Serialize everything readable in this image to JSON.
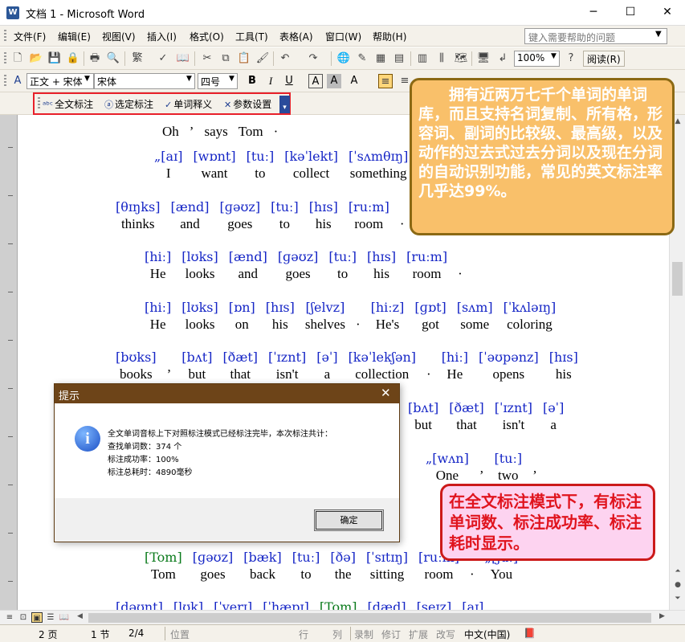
{
  "window": {
    "icon_letter": "W",
    "title": "文档 1 - Microsoft Word",
    "min": "─",
    "max": "☐",
    "close": "✕"
  },
  "menu": {
    "items": [
      "文件(F)",
      "编辑(E)",
      "视图(V)",
      "插入(I)",
      "格式(O)",
      "工具(T)",
      "表格(A)",
      "窗口(W)",
      "帮助(H)"
    ],
    "help_placeholder": "键入需要帮助的问题"
  },
  "toolbar": {
    "zoom": "100%",
    "reading": "阅读(R)",
    "style": "正文 + 宋体",
    "font": "宋体",
    "size": "四号",
    "bold": "B",
    "italic": "I",
    "underline": "U"
  },
  "addin": {
    "full_annotate": "全文标注",
    "selection_annotate": "选定标注",
    "word_definition": "单词释义",
    "settings": "参数设置"
  },
  "document": {
    "rows": [
      {
        "cells": [
          {
            "w": "Oh"
          },
          {
            "p": "’"
          },
          {
            "w": "says"
          },
          {
            "w": "Tom"
          },
          {
            "p": "·"
          }
        ]
      },
      {
        "cells": [
          {
            "ph": "„[aɪ]",
            "w": "I"
          },
          {
            "ph": "[wɒnt]",
            "w": "want"
          },
          {
            "ph": "[tuː]",
            "w": "to"
          },
          {
            "ph": "[kəˈlekt]",
            "w": "collect"
          },
          {
            "ph": "[ˈsʌmθɪŋ]",
            "w": "something"
          }
        ]
      },
      {
        "cells": [
          {
            "ph": "[θɪŋks]",
            "w": "thinks"
          },
          {
            "ph": "[ænd]",
            "w": "and"
          },
          {
            "ph": "[ɡəʊz]",
            "w": "goes"
          },
          {
            "ph": "[tuː]",
            "w": "to"
          },
          {
            "ph": "[hɪs]",
            "w": "his"
          },
          {
            "ph": "[ruːm]",
            "w": "room"
          },
          {
            "p": "·"
          }
        ]
      },
      {
        "cells": [
          {
            "ph": "[hiː]",
            "w": "He"
          },
          {
            "ph": "[lʊks]",
            "w": "looks"
          },
          {
            "ph": "[ænd]",
            "w": "and"
          },
          {
            "ph": "[ɡəʊz]",
            "w": "goes"
          },
          {
            "ph": "[tuː]",
            "w": "to"
          },
          {
            "ph": "[hɪs]",
            "w": "his"
          },
          {
            "ph": "[ruːm]",
            "w": "room"
          },
          {
            "p": "·"
          }
        ]
      },
      {
        "cells": [
          {
            "ph": "[hiː]",
            "w": "He"
          },
          {
            "ph": "[lʊks]",
            "w": "looks"
          },
          {
            "ph": "[ɒn]",
            "w": "on"
          },
          {
            "ph": "[hɪs]",
            "w": "his"
          },
          {
            "ph": "[ʃelvz]",
            "w": "shelves"
          },
          {
            "p": "·"
          },
          {
            "ph": "[hiːz]",
            "w": "He's"
          },
          {
            "ph": "[ɡɒt]",
            "w": "got"
          },
          {
            "ph": "[sʌm]",
            "w": "some"
          },
          {
            "ph": "[ˈkʌləɪŋ]",
            "w": "coloring"
          }
        ]
      },
      {
        "cells": [
          {
            "ph": "[bʊks]",
            "w": "books"
          },
          {
            "p": "’"
          },
          {
            "ph": "[bʌt]",
            "w": "but"
          },
          {
            "ph": "[ðæt]",
            "w": "that"
          },
          {
            "ph": "[ˈɪznt]",
            "w": "isn't"
          },
          {
            "ph": "[əˈ]",
            "w": "a"
          },
          {
            "ph": "[kəˈlekʃən]",
            "w": "collection"
          },
          {
            "p": "·"
          },
          {
            "ph": "[hiː]",
            "w": "He"
          },
          {
            "ph": "[ˈəʊpənz]",
            "w": "opens"
          },
          {
            "ph": "[hɪs]",
            "w": "his"
          }
        ]
      },
      {
        "cells": [
          {
            "ph": "[bʌt]",
            "w": "but"
          },
          {
            "ph": "[ðæt]",
            "w": "that"
          },
          {
            "ph": "[ˈɪznt]",
            "w": "isn't"
          },
          {
            "ph": "[əˈ]",
            "w": "a"
          }
        ]
      },
      {
        "cells": [
          {
            "ph": "„[wʌn]",
            "w": "One"
          },
          {
            "p": "’"
          },
          {
            "ph": "[tuː]",
            "w": "two"
          },
          {
            "p": "’"
          }
        ]
      },
      {
        "cells": [
          {
            "ph": "[Tom]",
            "w": "Tom",
            "g": true
          },
          {
            "ph": "[ɡəʊz]",
            "w": "goes"
          },
          {
            "ph": "[bæk]",
            "w": "back"
          },
          {
            "ph": "[tuː]",
            "w": "to"
          },
          {
            "ph": "[ðə]",
            "w": "the"
          },
          {
            "ph": "[ˈsɪtɪŋ]",
            "w": "sitting"
          },
          {
            "ph": "[ruːm]",
            "w": "room"
          },
          {
            "p": "·"
          },
          {
            "ph": "„[juː]",
            "w": "You"
          }
        ]
      },
      {
        "cells": [
          {
            "ph": "[dəʊnt]"
          },
          {
            "ph": "[lʊk]"
          },
          {
            "ph": "[ˈverɪ]"
          },
          {
            "ph": "[ˈhæpɪ]"
          },
          {
            "ph": "[Tom]",
            "g": true
          },
          {
            "ph": "[dæd]"
          },
          {
            "ph": "[seɪz]"
          },
          {
            "ph": "[aɪ]"
          }
        ]
      }
    ]
  },
  "callouts": {
    "top": "拥有近两万七千个单词的单词库，而且支持名词复制、所有格，形容词、副词的比较级、最高级，以及动作的过去式过去分词以及现在分词的自动识别功能，常见的英文标注率几乎达99%。",
    "bottom": "在全文标注模式下，有标注单词数、标注成功率、标注耗时显示。"
  },
  "dialog": {
    "title": "提示",
    "close": "✕",
    "info": "i",
    "lines": [
      "全文单词音标上下对照标注模式已经标注完毕，本次标注共计：",
      "查找单词数：374 个",
      "标注成功率：100%",
      "标注总耗时：4890毫秒"
    ],
    "ok": "确定"
  },
  "status": {
    "page": "2 页",
    "section": "1 节",
    "page_of": "2/4",
    "position": "位置",
    "line": "行",
    "col": "列",
    "rec": "录制",
    "trk": "修订",
    "ext": "扩展",
    "ovr": "改写",
    "lang": "中文(中国)"
  }
}
